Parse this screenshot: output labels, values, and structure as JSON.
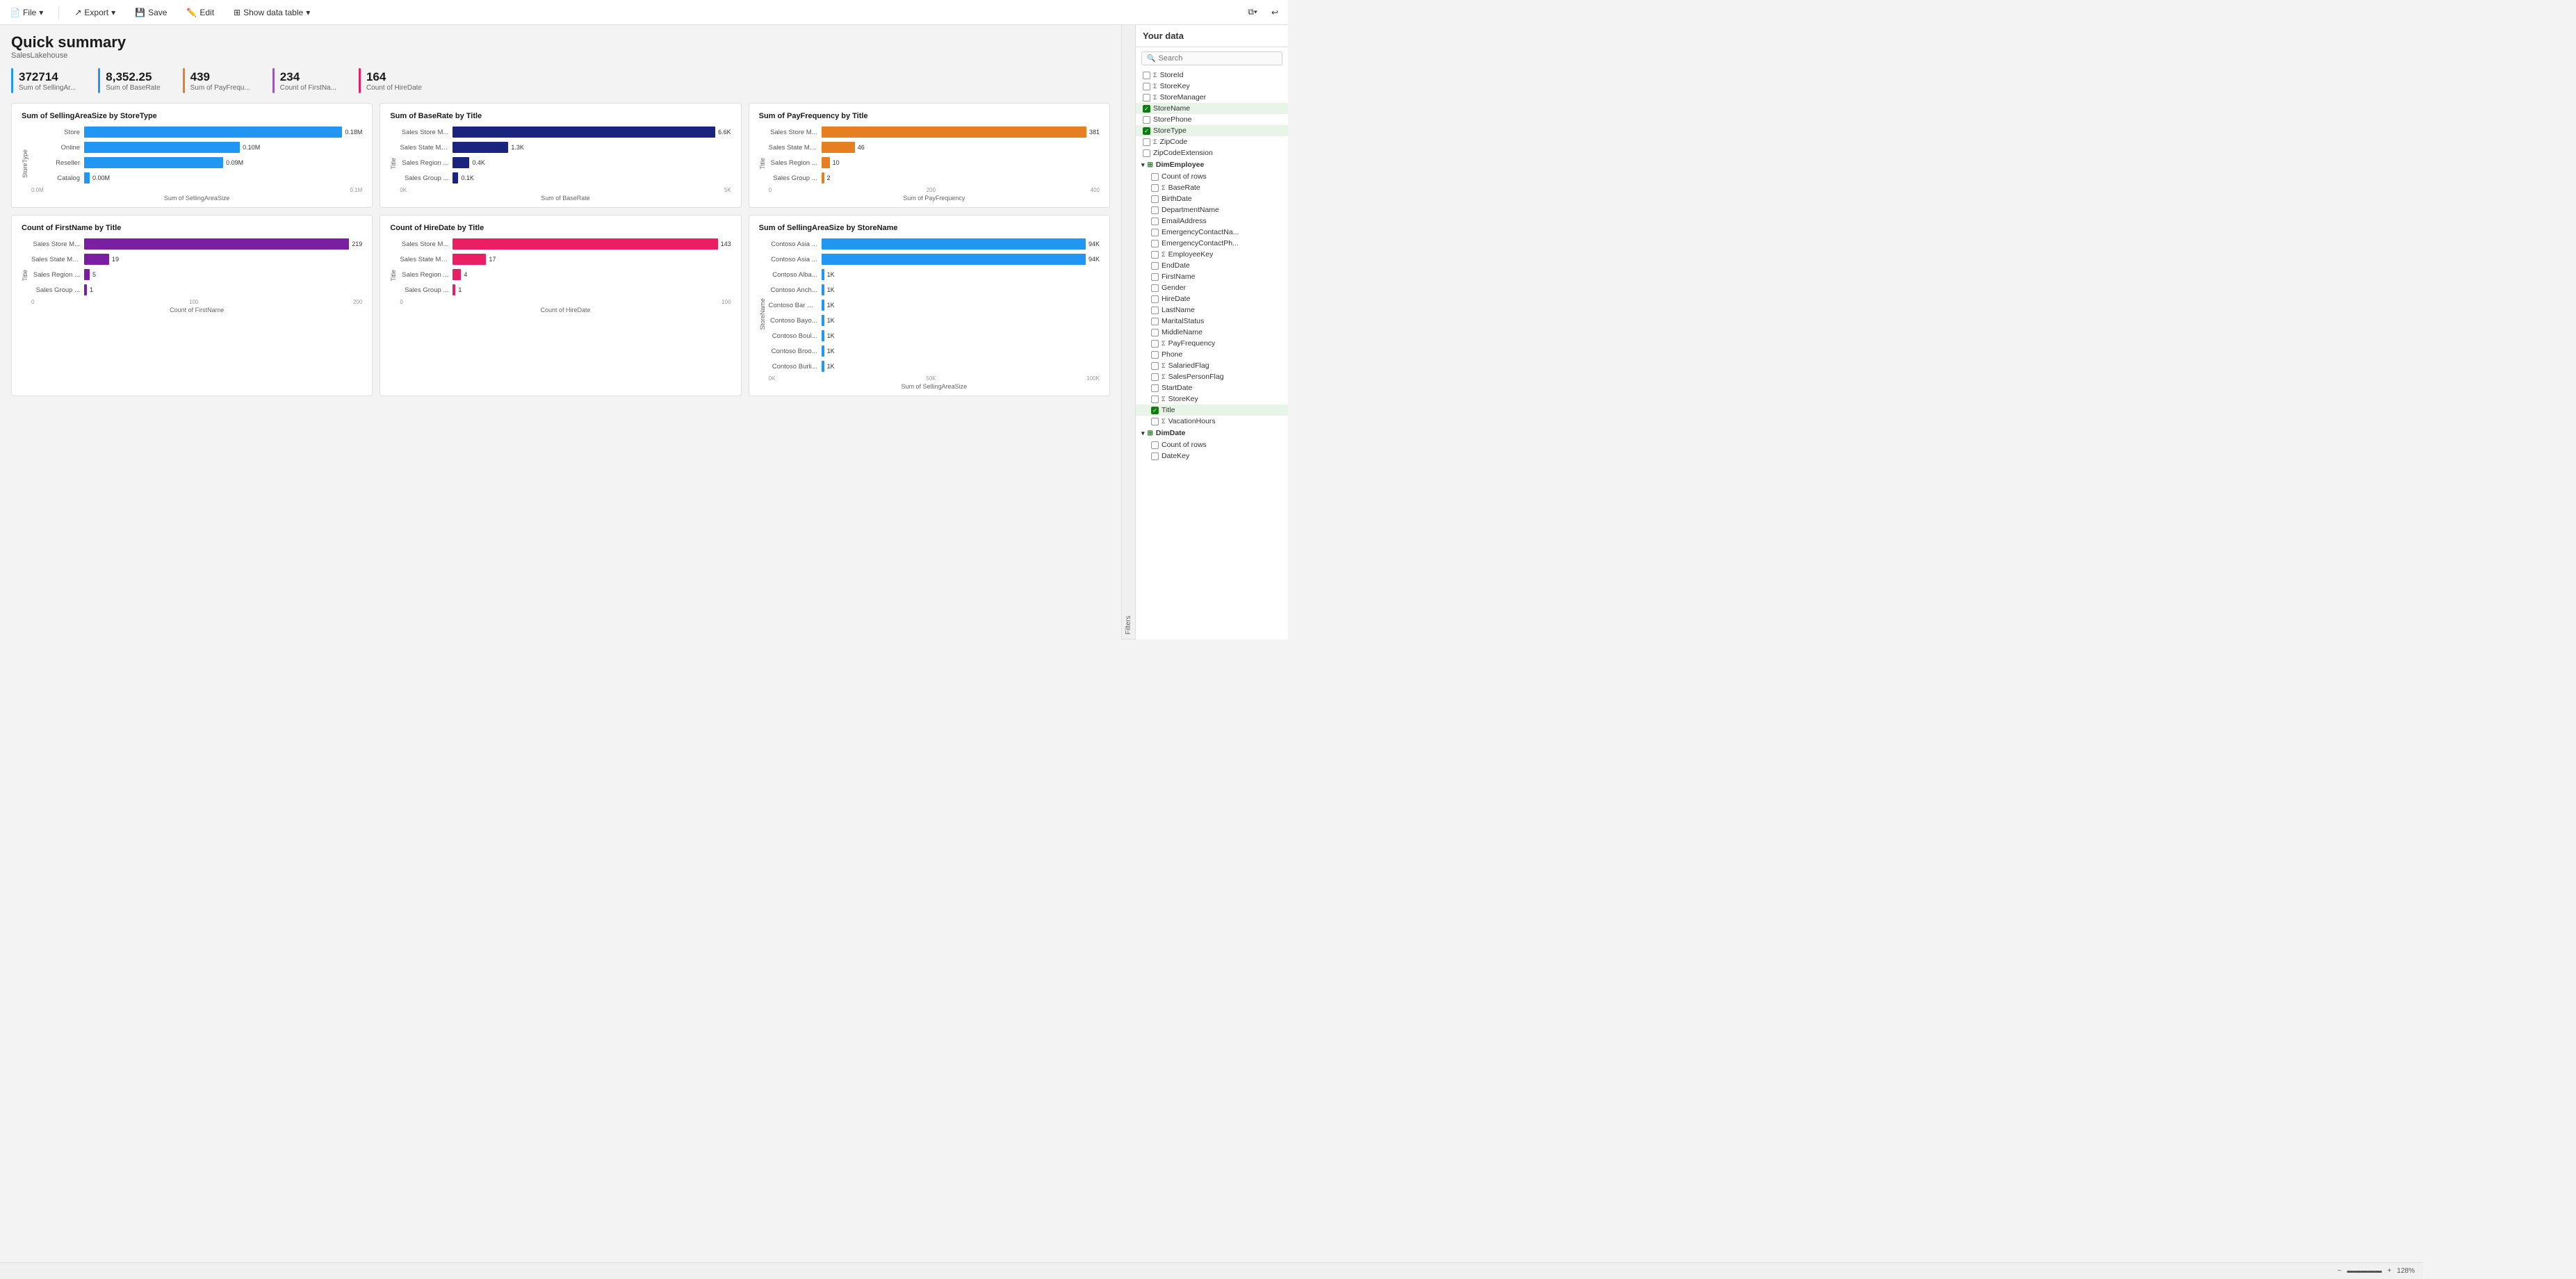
{
  "toolbar": {
    "file_label": "File",
    "export_label": "Export",
    "save_label": "Save",
    "edit_label": "Edit",
    "show_data_table_label": "Show data table"
  },
  "page": {
    "title": "Quick summary",
    "subtitle": "SalesLakehouse"
  },
  "kpis": [
    {
      "value": "372714",
      "label": "Sum of SellingAr...",
      "color": "#2196F3"
    },
    {
      "value": "8,352.25",
      "label": "Sum of BaseRate",
      "color": "#2196F3"
    },
    {
      "value": "439",
      "label": "Sum of PayFrequ...",
      "color": "#E67E22"
    },
    {
      "value": "234",
      "label": "Count of FirstNa...",
      "color": "#9B59B6"
    },
    {
      "value": "164",
      "label": "Count of HireDate",
      "color": "#E91E63"
    }
  ],
  "charts": {
    "row1": [
      {
        "title": "Sum of SellingAreaSize by StoreType",
        "y_axis_label": "StoreType",
        "x_axis_label": "Sum of SellingAreaSize",
        "bars": [
          {
            "label": "Store",
            "value": "0.18M",
            "pct": 100,
            "color": "#2196F3"
          },
          {
            "label": "Online",
            "value": "0.10M",
            "pct": 56,
            "color": "#2196F3"
          },
          {
            "label": "Reseller",
            "value": "0.09M",
            "pct": 50,
            "color": "#2196F3"
          },
          {
            "label": "Catalog",
            "value": "0.00M",
            "pct": 2,
            "color": "#2196F3"
          }
        ],
        "x_ticks": [
          "0.0M",
          "0.1M"
        ]
      },
      {
        "title": "Sum of BaseRate by Title",
        "y_axis_label": "Title",
        "x_axis_label": "Sum of BaseRate",
        "bars": [
          {
            "label": "Sales Store M...",
            "value": "6.6K",
            "pct": 100,
            "color": "#1A237E"
          },
          {
            "label": "Sales State Ma...",
            "value": "1.3K",
            "pct": 20,
            "color": "#1A237E"
          },
          {
            "label": "Sales Region ...",
            "value": "0.4K",
            "pct": 6,
            "color": "#1A237E"
          },
          {
            "label": "Sales Group ...",
            "value": "0.1K",
            "pct": 2,
            "color": "#1A237E"
          }
        ],
        "x_ticks": [
          "0K",
          "5K"
        ]
      },
      {
        "title": "Sum of PayFrequency by Title",
        "y_axis_label": "Title",
        "x_axis_label": "Sum of PayFrequency",
        "bars": [
          {
            "label": "Sales Store M...",
            "value": "381",
            "pct": 100,
            "color": "#E67E22"
          },
          {
            "label": "Sales State Ma...",
            "value": "46",
            "pct": 12,
            "color": "#E67E22"
          },
          {
            "label": "Sales Region ...",
            "value": "10",
            "pct": 3,
            "color": "#E67E22"
          },
          {
            "label": "Sales Group ...",
            "value": "2",
            "pct": 1,
            "color": "#E67E22"
          }
        ],
        "x_ticks": [
          "0",
          "200",
          "400"
        ]
      }
    ],
    "row2": [
      {
        "title": "Count of FirstName by Title",
        "y_axis_label": "Title",
        "x_axis_label": "Count of FirstName",
        "bars": [
          {
            "label": "Sales Store M...",
            "value": "219",
            "pct": 100,
            "color": "#7B1FA2"
          },
          {
            "label": "Sales State Ma...",
            "value": "19",
            "pct": 9,
            "color": "#7B1FA2"
          },
          {
            "label": "Sales Region ...",
            "value": "5",
            "pct": 2,
            "color": "#7B1FA2"
          },
          {
            "label": "Sales Group ...",
            "value": "1",
            "pct": 0.5,
            "color": "#7B1FA2"
          }
        ],
        "x_ticks": [
          "0",
          "100",
          "200"
        ]
      },
      {
        "title": "Count of HireDate by Title",
        "y_axis_label": "Title",
        "x_axis_label": "Count of HireDate",
        "bars": [
          {
            "label": "Sales Store M...",
            "value": "143",
            "pct": 100,
            "color": "#E91E63"
          },
          {
            "label": "Sales State Ma...",
            "value": "17",
            "pct": 12,
            "color": "#E91E63"
          },
          {
            "label": "Sales Region ...",
            "value": "4",
            "pct": 3,
            "color": "#E91E63"
          },
          {
            "label": "Sales Group ...",
            "value": "1",
            "pct": 1,
            "color": "#E91E63"
          }
        ],
        "x_ticks": [
          "0",
          "100"
        ]
      },
      {
        "title": "Sum of SellingAreaSize by StoreName",
        "y_axis_label": "StoreName",
        "x_axis_label": "Sum of SellingAreaSize",
        "bars": [
          {
            "label": "Contoso Asia ...",
            "value": "94K",
            "pct": 100,
            "color": "#2196F3"
          },
          {
            "label": "Contoso Asia ...",
            "value": "94K",
            "pct": 100,
            "color": "#2196F3"
          },
          {
            "label": "Contoso Alba...",
            "value": "1K",
            "pct": 1,
            "color": "#2196F3"
          },
          {
            "label": "Contoso Anch...",
            "value": "1K",
            "pct": 1,
            "color": "#2196F3"
          },
          {
            "label": "Contoso Bar H...",
            "value": "1K",
            "pct": 1,
            "color": "#2196F3"
          },
          {
            "label": "Contoso Bayo...",
            "value": "1K",
            "pct": 1,
            "color": "#2196F3"
          },
          {
            "label": "Contoso Boul...",
            "value": "1K",
            "pct": 1,
            "color": "#2196F3"
          },
          {
            "label": "Contoso Broo...",
            "value": "1K",
            "pct": 1,
            "color": "#2196F3"
          },
          {
            "label": "Contoso Burli...",
            "value": "1K",
            "pct": 1,
            "color": "#2196F3"
          }
        ],
        "x_ticks": [
          "0K",
          "50K",
          "100K"
        ]
      }
    ]
  },
  "sidebar": {
    "title": "Your data",
    "search_placeholder": "Search",
    "filters_label": "Filters",
    "tree": [
      {
        "type": "item",
        "indent": 1,
        "label": "StoreId",
        "icon": "sigma",
        "checked": false
      },
      {
        "type": "item",
        "indent": 1,
        "label": "StoreKey",
        "icon": "sigma",
        "checked": false
      },
      {
        "type": "item",
        "indent": 1,
        "label": "StoreManager",
        "icon": "sigma",
        "checked": false
      },
      {
        "type": "item",
        "indent": 1,
        "label": "StoreName",
        "icon": "",
        "checked": true
      },
      {
        "type": "item",
        "indent": 1,
        "label": "StorePhone",
        "icon": "",
        "checked": false
      },
      {
        "type": "item",
        "indent": 1,
        "label": "StoreType",
        "icon": "",
        "checked": true
      },
      {
        "type": "item",
        "indent": 1,
        "label": "ZipCode",
        "icon": "sigma",
        "checked": false
      },
      {
        "type": "item",
        "indent": 1,
        "label": "ZipCodeExtension",
        "icon": "",
        "checked": false
      },
      {
        "type": "section",
        "label": "DimEmployee",
        "expanded": true
      },
      {
        "type": "item",
        "indent": 2,
        "label": "Count of rows",
        "icon": "",
        "checked": false
      },
      {
        "type": "item",
        "indent": 2,
        "label": "BaseRate",
        "icon": "sigma",
        "checked": false
      },
      {
        "type": "item",
        "indent": 2,
        "label": "BirthDate",
        "icon": "",
        "checked": false
      },
      {
        "type": "item",
        "indent": 2,
        "label": "DepartmentName",
        "icon": "",
        "checked": false
      },
      {
        "type": "item",
        "indent": 2,
        "label": "EmailAddress",
        "icon": "",
        "checked": false
      },
      {
        "type": "item",
        "indent": 2,
        "label": "EmergencyContactNa...",
        "icon": "",
        "checked": false
      },
      {
        "type": "item",
        "indent": 2,
        "label": "EmergencyContactPh...",
        "icon": "",
        "checked": false
      },
      {
        "type": "item",
        "indent": 2,
        "label": "EmployeeKey",
        "icon": "sigma",
        "checked": false
      },
      {
        "type": "item",
        "indent": 2,
        "label": "EndDate",
        "icon": "",
        "checked": false
      },
      {
        "type": "item",
        "indent": 2,
        "label": "FirstName",
        "icon": "",
        "checked": false
      },
      {
        "type": "item",
        "indent": 2,
        "label": "Gender",
        "icon": "",
        "checked": false
      },
      {
        "type": "item",
        "indent": 2,
        "label": "HireDate",
        "icon": "",
        "checked": false
      },
      {
        "type": "item",
        "indent": 2,
        "label": "LastName",
        "icon": "",
        "checked": false
      },
      {
        "type": "item",
        "indent": 2,
        "label": "MaritalStatus",
        "icon": "",
        "checked": false
      },
      {
        "type": "item",
        "indent": 2,
        "label": "MiddleName",
        "icon": "",
        "checked": false
      },
      {
        "type": "item",
        "indent": 2,
        "label": "PayFrequency",
        "icon": "sigma",
        "checked": false
      },
      {
        "type": "item",
        "indent": 2,
        "label": "Phone",
        "icon": "",
        "checked": false
      },
      {
        "type": "item",
        "indent": 2,
        "label": "SalariedFlag",
        "icon": "sigma",
        "checked": false
      },
      {
        "type": "item",
        "indent": 2,
        "label": "SalesPersonFlag",
        "icon": "sigma",
        "checked": false
      },
      {
        "type": "item",
        "indent": 2,
        "label": "StartDate",
        "icon": "",
        "checked": false
      },
      {
        "type": "item",
        "indent": 2,
        "label": "StoreKey",
        "icon": "sigma",
        "checked": false
      },
      {
        "type": "item",
        "indent": 2,
        "label": "Title",
        "icon": "",
        "checked": true
      },
      {
        "type": "item",
        "indent": 2,
        "label": "VacationHours",
        "icon": "sigma",
        "checked": false
      },
      {
        "type": "section",
        "label": "DimDate",
        "expanded": true
      },
      {
        "type": "item",
        "indent": 2,
        "label": "Count of rows",
        "icon": "",
        "checked": false
      },
      {
        "type": "item",
        "indent": 2,
        "label": "DateKey",
        "icon": "",
        "checked": false
      }
    ]
  },
  "bottom_bar": {
    "zoom_label": "128%"
  }
}
